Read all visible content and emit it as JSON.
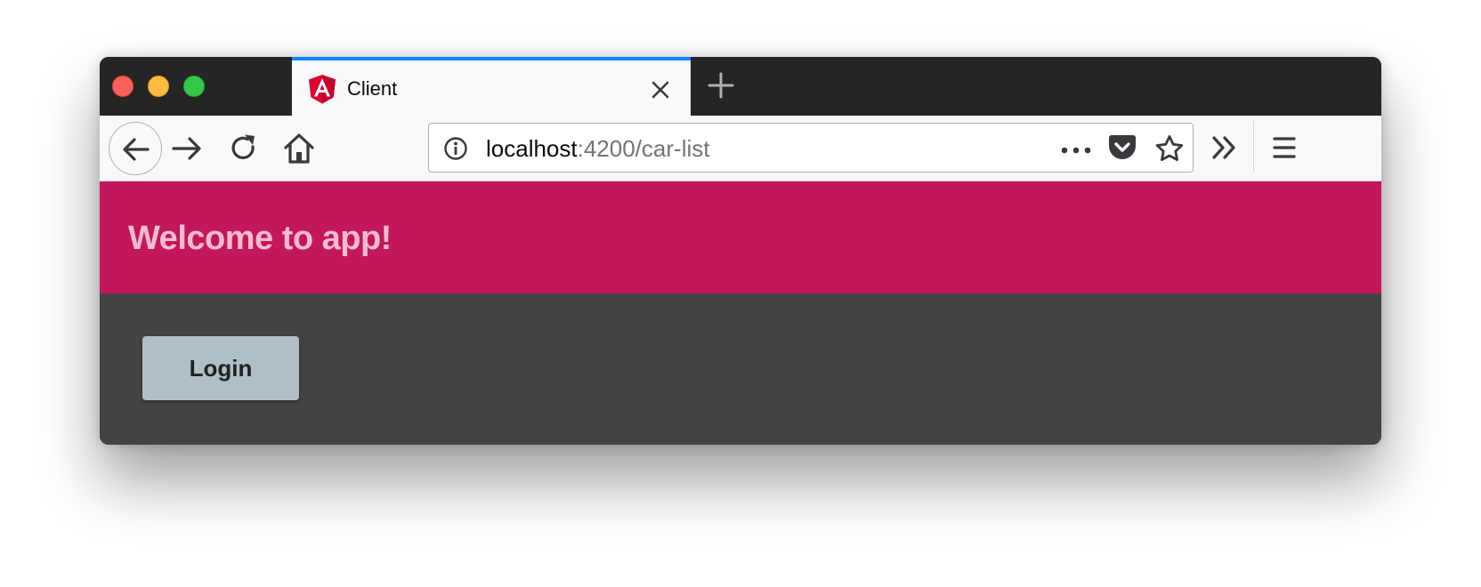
{
  "browser": {
    "tab": {
      "title": "Client"
    },
    "url": {
      "host": "localhost",
      "rest": ":4200/car-list"
    }
  },
  "app": {
    "header_title": "Welcome to app!",
    "login_label": "Login"
  },
  "colors": {
    "header_bg": "#c2185b",
    "header_text": "#f8bbd0",
    "content_bg": "#434343",
    "button_bg": "#b0bec5",
    "tab_accent": "#0a84ff"
  },
  "icons": {
    "favicon": "angular-logo-icon",
    "tab_close": "close-icon",
    "new_tab": "plus-icon",
    "back": "arrow-left-icon",
    "forward": "arrow-right-icon",
    "reload": "reload-icon",
    "home": "home-icon",
    "info": "info-icon",
    "more": "more-dots-icon",
    "pocket": "pocket-icon",
    "bookmark": "star-icon",
    "overflow": "double-chevron-icon",
    "menu": "hamburger-menu-icon"
  }
}
